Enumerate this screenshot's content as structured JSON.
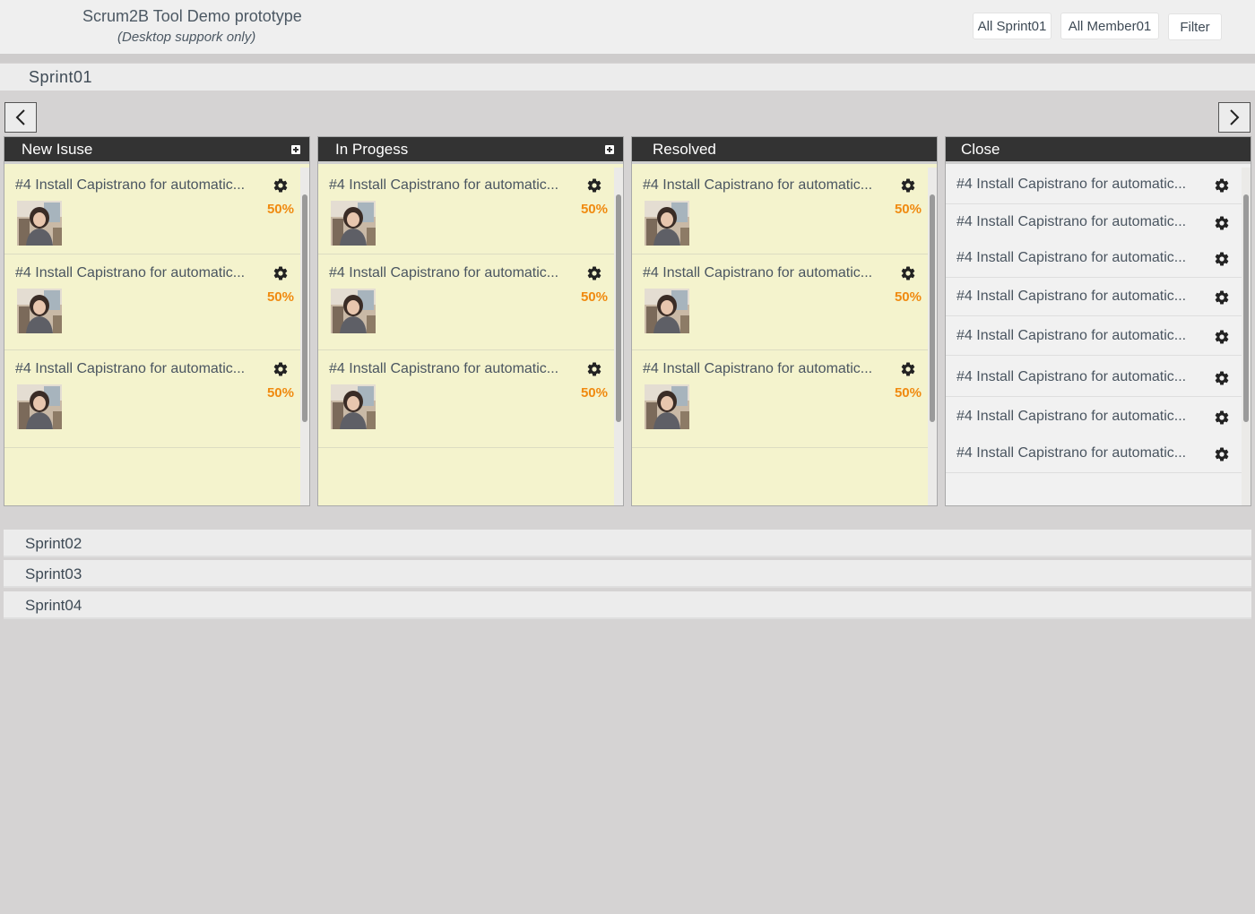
{
  "header": {
    "title": "Scrum2B Tool Demo prototype",
    "subtitle": "(Desktop suppork only)",
    "sprint_filter": "All Sprint01",
    "member_filter": "All Member01",
    "filter_label": "Filter"
  },
  "sprint": {
    "name": "Sprint01"
  },
  "columns": [
    {
      "title": "New Isuse",
      "cards": [
        {
          "title": "#4 Install Capistrano for automatic...",
          "progress": "50%"
        },
        {
          "title": "#4 Install Capistrano for automatic...",
          "progress": "50%"
        },
        {
          "title": "#4 Install Capistrano for automatic...",
          "progress": "50%"
        }
      ]
    },
    {
      "title": "In Progess",
      "cards": [
        {
          "title": "#4 Install Capistrano for automatic...",
          "progress": "50%"
        },
        {
          "title": "#4 Install Capistrano for automatic...",
          "progress": "50%"
        },
        {
          "title": "#4 Install Capistrano for automatic...",
          "progress": "50%"
        }
      ]
    },
    {
      "title": "Resolved",
      "cards": [
        {
          "title": "#4 Install Capistrano for automatic...",
          "progress": "50%"
        },
        {
          "title": "#4 Install Capistrano for automatic...",
          "progress": "50%"
        },
        {
          "title": "#4 Install Capistrano for automatic...",
          "progress": "50%"
        }
      ]
    },
    {
      "title": "Close",
      "items": [
        "#4 Install Capistrano for automatic...",
        "#4 Install Capistrano for automatic...",
        "#4 Install Capistrano for automatic...",
        "#4 Install Capistrano for automatic...",
        "#4 Install Capistrano for automatic...",
        "#4 Install Capistrano for automatic...",
        "#4 Install Capistrano for automatic...",
        "#4 Install Capistrano for automatic..."
      ]
    }
  ],
  "other_sprints": [
    "Sprint02",
    "Sprint03",
    "Sprint04"
  ],
  "colors": {
    "accent": "#f08a10",
    "column_header": "#333333",
    "card_bg": "#f4f3cd"
  }
}
